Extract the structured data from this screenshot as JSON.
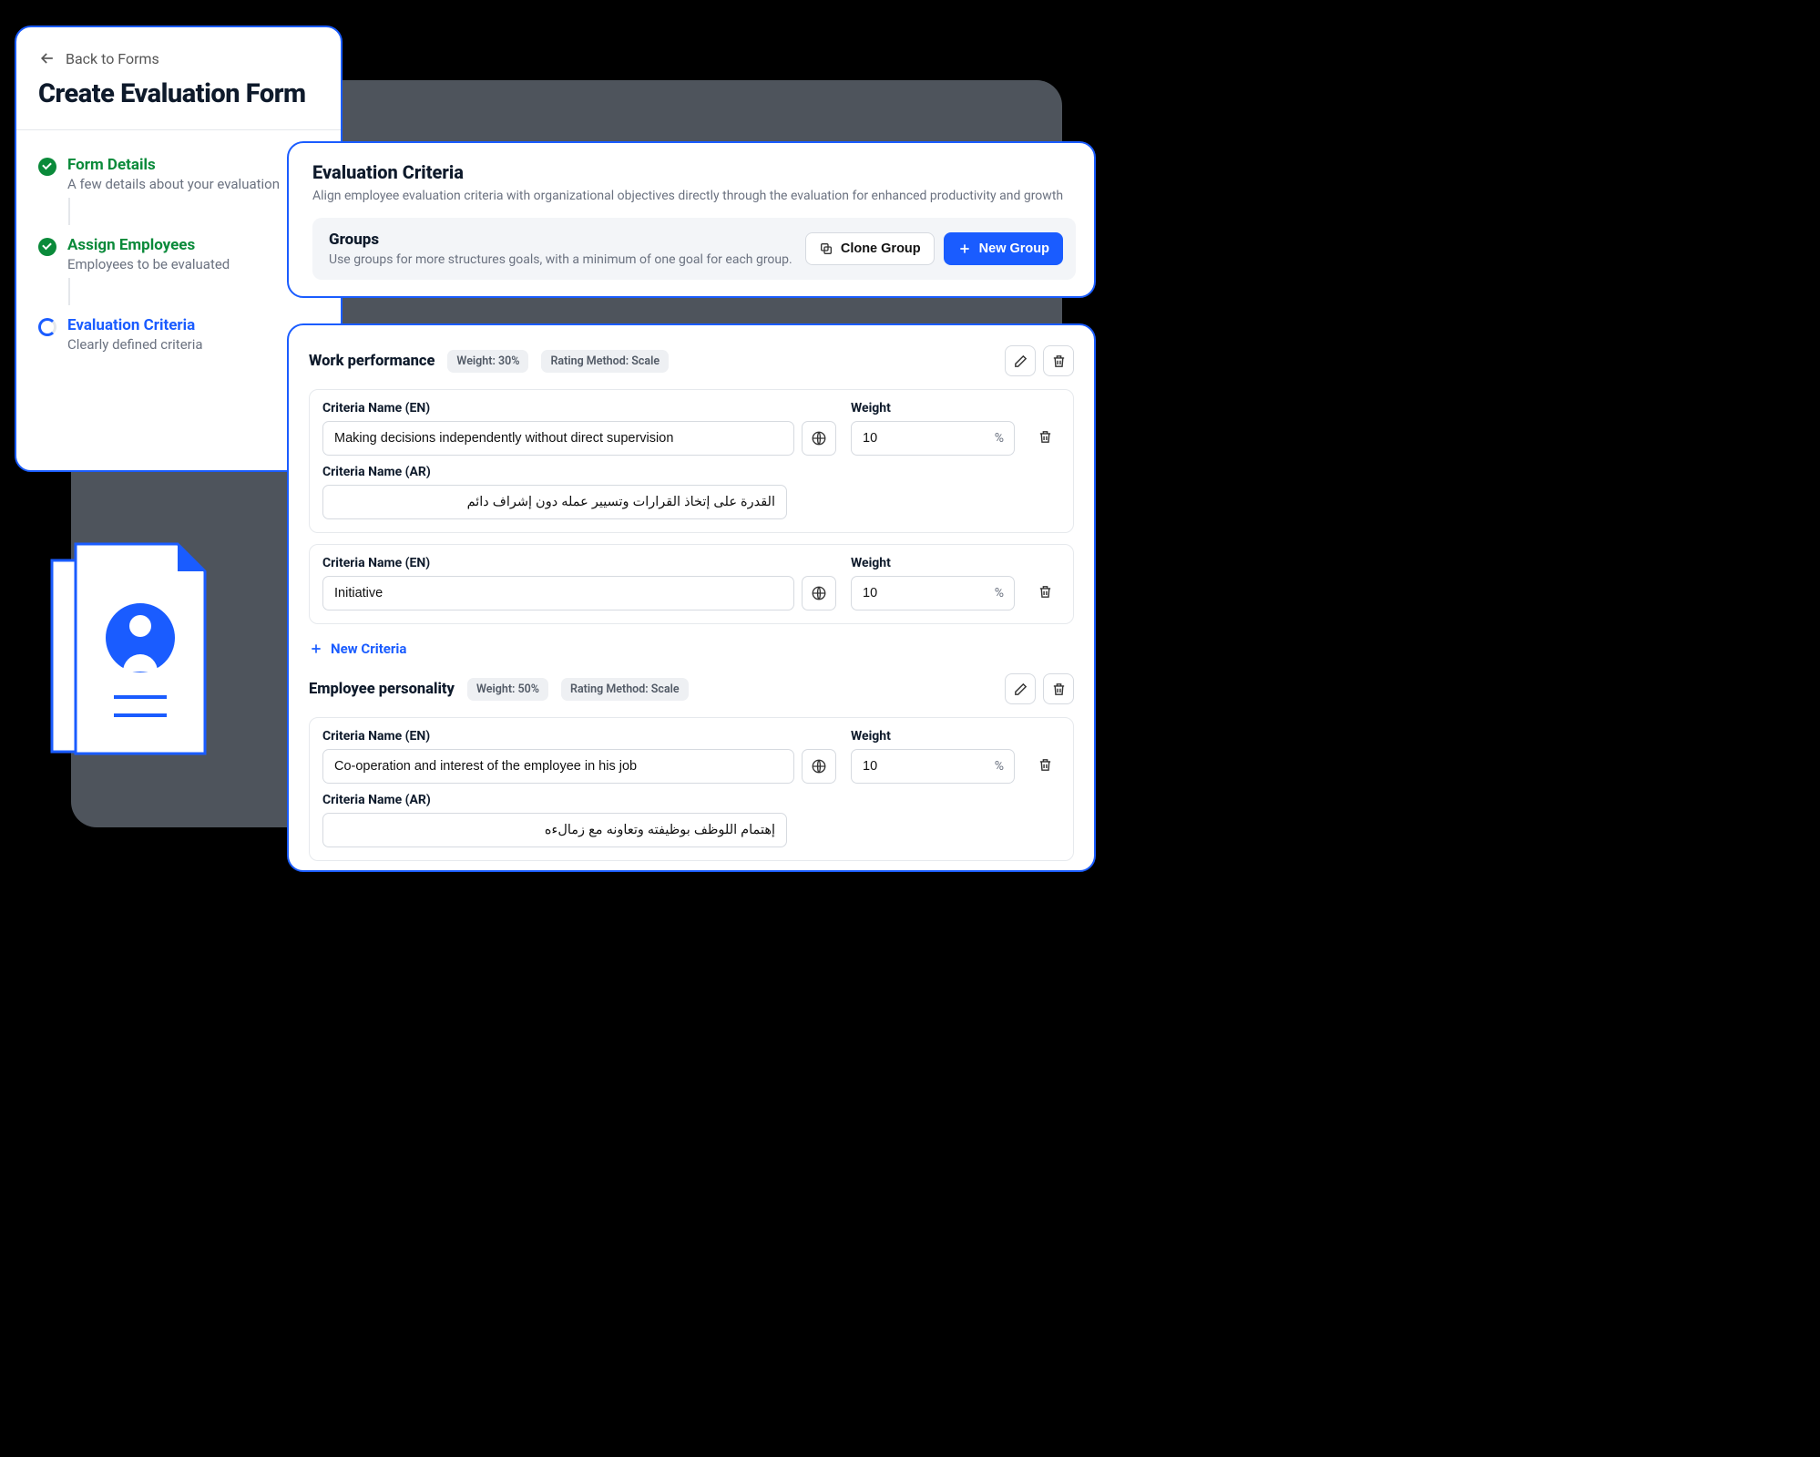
{
  "leftCard": {
    "back": "Back to Forms",
    "title": "Create Evaluation Form",
    "steps": [
      {
        "title": "Form Details",
        "sub": "A few details about your evaluation"
      },
      {
        "title": "Assign Employees",
        "sub": "Employees to be evaluated"
      },
      {
        "title": "Evaluation Criteria",
        "sub": "Clearly defined criteria"
      }
    ]
  },
  "criteriaHeader": {
    "title": "Evaluation Criteria",
    "desc": "Align employee evaluation criteria with organizational objectives directly through the evaluation for enhanced productivity and growth",
    "groups": {
      "title": "Groups",
      "desc": "Use groups for more structures goals, with a minimum of one goal for each group.",
      "cloneLabel": "Clone Group",
      "newLabel": "New Group"
    }
  },
  "labels": {
    "critEn": "Criteria Name (EN)",
    "critAr": "Criteria Name (AR)",
    "weight": "Weight",
    "percent": "%",
    "newCriteria": "New Criteria"
  },
  "groups": [
    {
      "name": "Work performance",
      "weightPill": "Weight: 30%",
      "methodPill": "Rating Method: Scale",
      "criteria": [
        {
          "en": "Making decisions independently without direct supervision",
          "ar": "القدرة على إتخاذ القرارات وتسيير عمله دون إشراف دائم",
          "weight": "10"
        },
        {
          "en": "Initiative",
          "ar": "",
          "weight": "10"
        }
      ]
    },
    {
      "name": "Employee personality",
      "weightPill": "Weight: 50%",
      "methodPill": "Rating Method: Scale",
      "criteria": [
        {
          "en": "Co-operation and interest of the employee in his job",
          "ar": "إهتمام اللوظف بوظيفته وتعاونه مع زمالءه",
          "weight": "10"
        }
      ]
    }
  ]
}
